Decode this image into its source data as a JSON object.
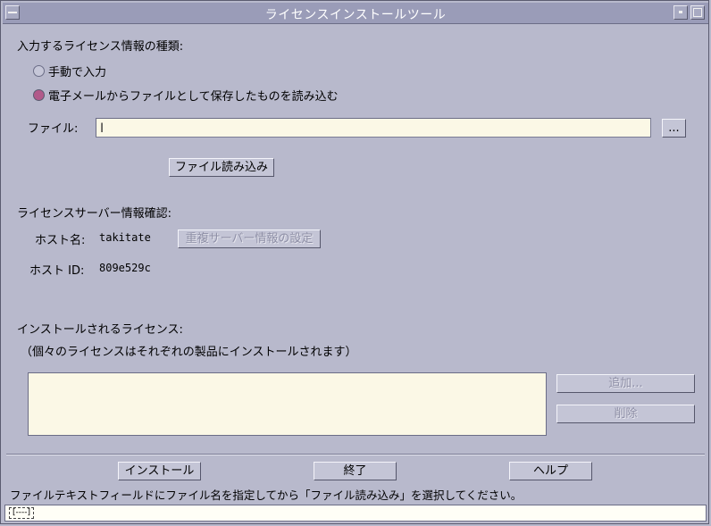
{
  "window": {
    "title": "ライセンスインストールツール",
    "menu_icon": "window-menu-icon",
    "minimize_icon": "minimize-icon",
    "maximize_icon": "maximize-icon"
  },
  "license_type": {
    "heading": "入力するライセンス情報の種類:",
    "options": [
      {
        "label": "手動で入力",
        "selected": false
      },
      {
        "label": "電子メールからファイルとして保存したものを読み込む",
        "selected": true
      }
    ]
  },
  "file": {
    "label": "ファイル:",
    "value": "",
    "browse_label": "...",
    "load_button": "ファイル読み込み"
  },
  "server": {
    "heading": "ライセンスサーバー情報確認:",
    "host_name_label": "ホスト名:",
    "host_name_value": "takitate",
    "redundant_button": "重複サーバー情報の設定",
    "host_id_label": "ホスト ID:",
    "host_id_value": "809e529c"
  },
  "licenses": {
    "heading": "インストールされるライセンス:",
    "note": "（個々のライセンスはそれぞれの製品にインストールされます）",
    "add_button": "追加...",
    "delete_button": "削除"
  },
  "footer": {
    "install_button": "インストール",
    "exit_button": "終了",
    "help_button": "ヘルプ",
    "hint": "ファイルテキストフィールドにファイル名を指定してから「ファイル読み込み」を選択してください。",
    "status_indicator": "[----]"
  },
  "colors": {
    "background": "#b8b9cc",
    "titlebar": "#9a9cb8",
    "field": "#fbf8e6",
    "radio_selected": "#b15a8a"
  }
}
